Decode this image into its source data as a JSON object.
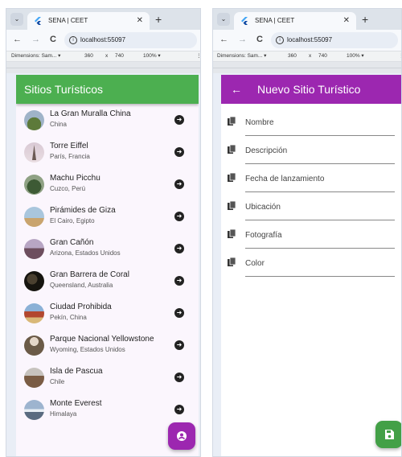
{
  "browser": {
    "tab_title": "SENA | CEET",
    "url": "localhost:55097",
    "device": "Dimensions: Sam...",
    "width_value": "360",
    "times": "x",
    "height_value": "740",
    "zoom": "100%",
    "more": "⋮"
  },
  "left_app": {
    "title": "Sitios Turísticos",
    "items": [
      {
        "title": "La Gran Muralla China",
        "subtitle": "China"
      },
      {
        "title": "Torre Eiffel",
        "subtitle": "París, Francia"
      },
      {
        "title": "Machu Picchu",
        "subtitle": "Cuzco, Perú"
      },
      {
        "title": "Pirámides de Giza",
        "subtitle": "El Cairo, Egipto"
      },
      {
        "title": "Gran Cañón",
        "subtitle": "Arizona, Estados Unidos"
      },
      {
        "title": "Gran Barrera de Coral",
        "subtitle": "Queensland, Australia"
      },
      {
        "title": "Ciudad Prohibida",
        "subtitle": "Pekín, China"
      },
      {
        "title": "Parque Nacional Yellowstone",
        "subtitle": "Wyoming, Estados Unidos"
      },
      {
        "title": "Isla de Pascua",
        "subtitle": "Chile"
      },
      {
        "title": "Monte Everest",
        "subtitle": "Himalaya"
      }
    ],
    "fab_icon": "account-circle-icon"
  },
  "right_app": {
    "title": "Nuevo Sitio Turístico",
    "back_icon": "arrow-back-icon",
    "fields": [
      {
        "label": "Nombre"
      },
      {
        "label": "Descripción"
      },
      {
        "label": "Fecha de lanzamiento"
      },
      {
        "label": "Ubicación"
      },
      {
        "label": "Fotografía"
      },
      {
        "label": "Color"
      }
    ],
    "fab_icon": "save-icon"
  },
  "colors": {
    "green_appbar": "#4caf50",
    "purple_appbar": "#9c27b0",
    "fab_purple": "#9c27b0",
    "fab_green": "#43a047"
  }
}
